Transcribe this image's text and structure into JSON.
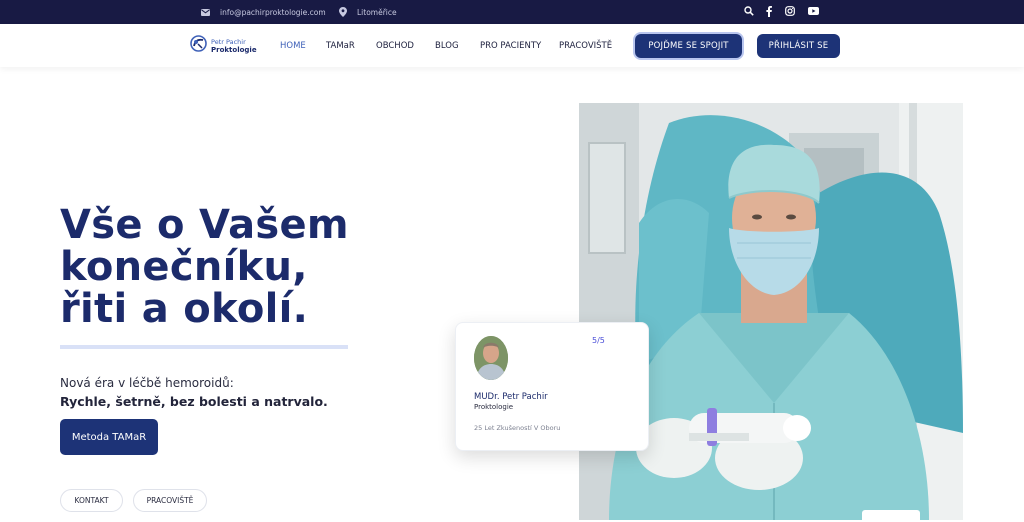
{
  "topbar": {
    "email": "info@pachirproktologie.com",
    "location": "Litoměřice",
    "icons": [
      "mail-icon",
      "map-pin-icon",
      "search-icon",
      "facebook-icon",
      "instagram-icon",
      "youtube-icon"
    ]
  },
  "logo": {
    "line1": "Petr Pachir",
    "line2": "Proktologie"
  },
  "nav": {
    "items": [
      "HOME",
      "TAMaR",
      "OBCHOD",
      "BLOG",
      "PRO PACIENTY",
      "PRACOVIŠTĚ"
    ],
    "active": "HOME",
    "connect_label": "POJĎME SE SPOJIT",
    "login_label": "PŘIHLÁSIT SE"
  },
  "hero": {
    "title_line1": "Vše o Vašem",
    "title_line2": "konečníku,",
    "title_line3": "řiti a okolí.",
    "lead": "Nová éra v léčbě hemoroidů:",
    "lead_bold": "Rychle, šetrně, bez bolesti a natrvalo.",
    "cta_label": "Metoda TAMaR",
    "pill_contact": "KONTAKT",
    "pill_workplace": "PRACOVIŠTĚ"
  },
  "card": {
    "rating": "5/5",
    "name": "MUDr. Petr Pachir",
    "role": "Proktologie",
    "experience": "25 Let Zkušeností V Oboru"
  },
  "colors": {
    "topbar_bg": "#181a44",
    "brand_navy": "#1d3377",
    "title_navy": "#1c2b6b",
    "accent_blue": "#3f61b8",
    "rating_purple": "#4b4fd8"
  }
}
